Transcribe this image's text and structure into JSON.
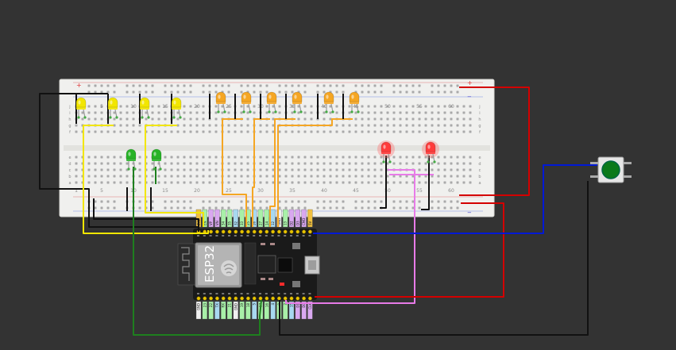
{
  "breadboard": {
    "plus_sign": "+",
    "minus_sign": "−",
    "column_numbers": [
      "1",
      "5",
      "10",
      "15",
      "20",
      "25",
      "30",
      "35",
      "40",
      "45",
      "50",
      "55",
      "60"
    ],
    "top_row_letters": [
      "j",
      "i",
      "h",
      "g",
      "f"
    ],
    "bottom_row_letters": [
      "e",
      "d",
      "c",
      "b",
      "a"
    ]
  },
  "esp32": {
    "board_label": "ESP32",
    "top_header_pins": [
      "3V3",
      "EN",
      "VP",
      "VN",
      "34",
      "35",
      "32",
      "33",
      "25",
      "26",
      "27",
      "14",
      "12",
      "GND",
      "13",
      "D2",
      "D3",
      "CMD",
      "5V"
    ],
    "bottom_header_pins": [
      "GND",
      "23",
      "22",
      "TX",
      "RX",
      "21",
      "GND",
      "19",
      "18",
      "5",
      "17",
      "16",
      "4",
      "0",
      "2",
      "15",
      "D1",
      "D0",
      "CLK"
    ]
  },
  "components": {
    "yellow_leds": 4,
    "orange_leds": 6,
    "green_leds": 2,
    "red_leds": 2,
    "pushbutton": "green pushbutton"
  },
  "colors": {
    "background": "#333333",
    "wire_black": "#111111",
    "wire_yellow": "#f2e600",
    "wire_orange": "#f5a623",
    "wire_green": "#1e7f1e",
    "wire_red": "#d40000",
    "wire_blue": "#0019d6",
    "wire_pink": "#e87be8"
  }
}
